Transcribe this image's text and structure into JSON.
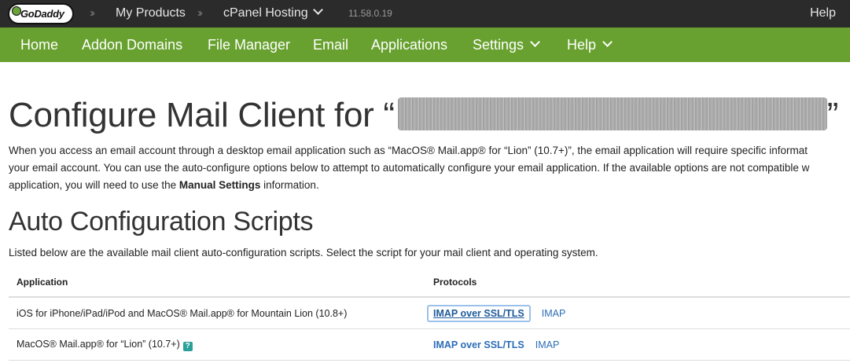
{
  "topbar": {
    "logo_text": "GoDaddy",
    "breadcrumb_1": "My Products",
    "breadcrumb_2": "cPanel Hosting",
    "version": "11.58.0.19",
    "help": "Help"
  },
  "nav": {
    "items": [
      {
        "label": "Home"
      },
      {
        "label": "Addon Domains"
      },
      {
        "label": "File Manager"
      },
      {
        "label": "Email"
      },
      {
        "label": "Applications"
      },
      {
        "label": "Settings"
      },
      {
        "label": "Help"
      }
    ]
  },
  "page": {
    "title": "Configure Mail Client for “",
    "title_tail": "”",
    "intro_line_1": "When you access an email account through a desktop email application such as “MacOS® Mail.app® for “Lion” (10.7+)”, the email application will require specific informat",
    "intro_line_2": "your email account. You can use the auto-configure options below to attempt to automatically configure your email application. If the available options are not compatible w",
    "intro_line_3_pre": "application, you will need to use the ",
    "intro_line_3_bold": "Manual Settings",
    "intro_line_3_post": " information."
  },
  "auto_config": {
    "title": "Auto Configuration Scripts",
    "description": "Listed below are the available mail client auto-configuration scripts. Select the script for your mail client and operating system.",
    "columns": [
      "Application",
      "Protocols"
    ],
    "rows": [
      {
        "application": "iOS for iPhone/iPad/iPod and MacOS® Mail.app® for Mountain Lion (10.8+)",
        "protocol_ssl": "IMAP over SSL/TLS",
        "protocol_plain": "IMAP"
      },
      {
        "application": "MacOS® Mail.app® for “Lion” (10.7+)",
        "help_badge": "?",
        "protocol_ssl": "IMAP over SSL/TLS",
        "protocol_plain": "IMAP"
      }
    ]
  },
  "colors": {
    "topbar": "#2b2b2b",
    "navbar": "#68a12f",
    "link": "#2d6db5"
  }
}
